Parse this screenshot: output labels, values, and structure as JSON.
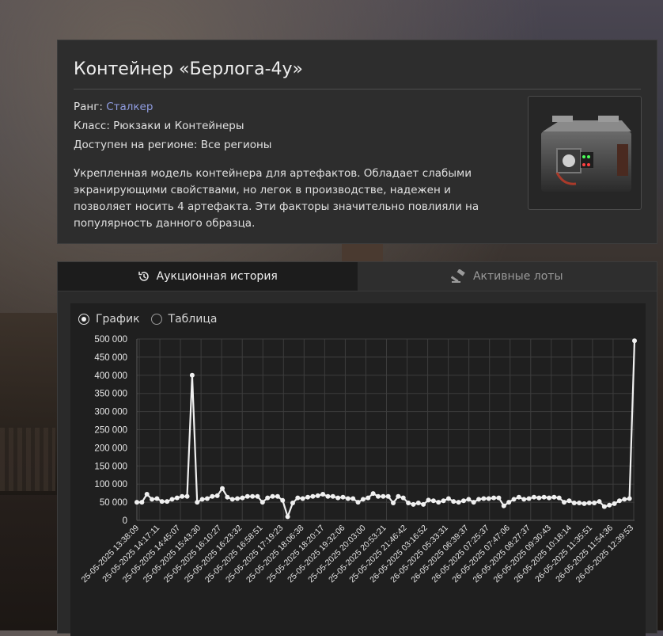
{
  "item": {
    "title": "Контейнер «Берлога-4у»",
    "rank_label": "Ранг: ",
    "rank_value": "Сталкер",
    "class_line": "Класс: Рюкзаки и Контейнеры",
    "region_line": "Доступен на регионе: Все регионы",
    "description": "Укрепленная модель контейнера для артефактов. Обладает слабыми экранирующими свойствами, но легок в производстве, надежен и позволяет носить 4 артефакта. Эти факторы значительно повлияли на популярность данного образца."
  },
  "tabs": [
    {
      "label": "Аукционная история",
      "icon": "history-icon"
    },
    {
      "label": "Активные лоты",
      "icon": "gavel-icon"
    }
  ],
  "view_options": [
    {
      "label": "График",
      "selected": true
    },
    {
      "label": "Таблица",
      "selected": false
    }
  ],
  "colors": {
    "link": "#8f9ce0",
    "line": "#f0f0f0"
  },
  "chart_data": {
    "type": "line",
    "ylim": [
      0,
      500000
    ],
    "y_ticks": [
      "500 000",
      "450 000",
      "400 000",
      "350 000",
      "300 000",
      "250 000",
      "200 000",
      "150 000",
      "100 000",
      "50 000",
      "0"
    ],
    "x_tick_labels": [
      "25-05-2025 13:38:09",
      "25-05-2025 14:17:11",
      "25-05-2025 14:45:07",
      "25-05-2025 15:43:30",
      "25-05-2025 16:10:27",
      "25-05-2025 16:23:32",
      "25-05-2025 16:58:51",
      "25-05-2025 17:19:23",
      "25-05-2025 18:06:38",
      "25-05-2025 18:20:17",
      "25-05-2025 19:32:06",
      "25-05-2025 20:03:00",
      "25-05-2025 20:53:21",
      "25-05-2025 21:46:42",
      "26-05-2025 03:16:52",
      "26-05-2025 05:33:31",
      "26-05-2025 06:39:37",
      "26-05-2025 07:25:37",
      "26-05-2025 07:47:06",
      "26-05-2025 08:27:37",
      "26-05-2025 09:30:43",
      "26-05-2025 10:18:14",
      "26-05-2025 11:35:51",
      "26-05-2025 11:54:36",
      "26-05-2025 12:39:53"
    ],
    "values": [
      50000,
      50000,
      72000,
      58000,
      60000,
      52000,
      52000,
      58000,
      62000,
      66000,
      66000,
      400000,
      50000,
      58000,
      60000,
      66000,
      68000,
      88000,
      64000,
      58000,
      60000,
      62000,
      66000,
      66000,
      66000,
      50000,
      62000,
      66000,
      66000,
      55000,
      10000,
      48000,
      62000,
      60000,
      64000,
      66000,
      68000,
      72000,
      66000,
      66000,
      62000,
      64000,
      60000,
      60000,
      50000,
      58000,
      62000,
      74000,
      66000,
      66000,
      66000,
      48000,
      66000,
      62000,
      48000,
      44000,
      48000,
      44000,
      56000,
      54000,
      50000,
      54000,
      60000,
      52000,
      50000,
      54000,
      58000,
      50000,
      58000,
      60000,
      60000,
      62000,
      62000,
      40000,
      50000,
      58000,
      64000,
      58000,
      60000,
      64000,
      62000,
      64000,
      62000,
      64000,
      62000,
      50000,
      54000,
      48000,
      48000,
      46000,
      48000,
      48000,
      52000,
      38000,
      42000,
      46000,
      54000,
      58000,
      60000,
      495000
    ]
  }
}
